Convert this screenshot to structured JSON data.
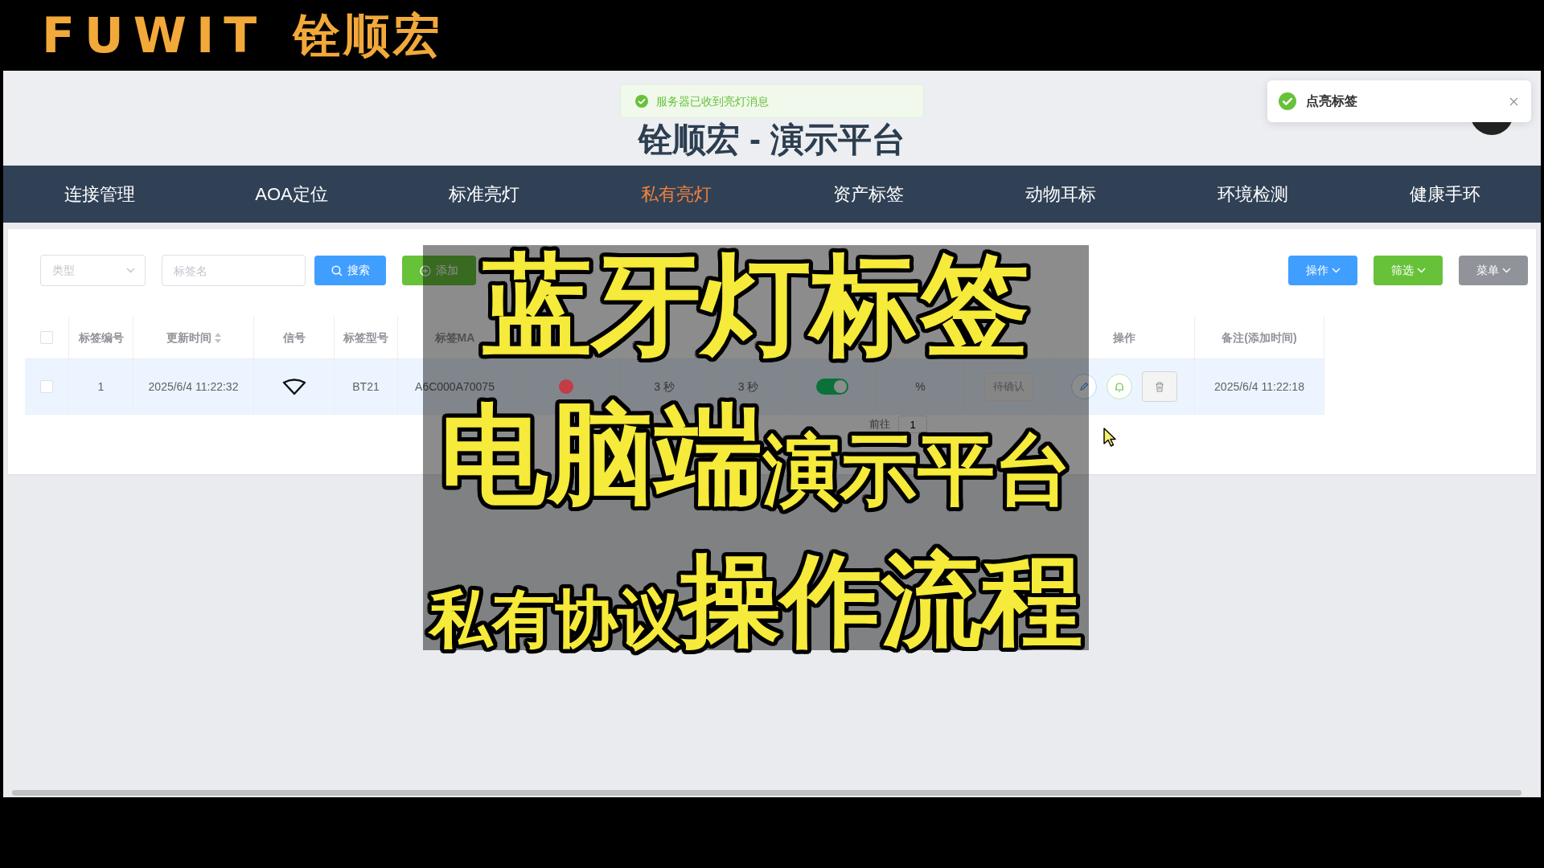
{
  "video_banner": {
    "brand": "FUWIT",
    "brand_cn": "铨顺宏"
  },
  "header": {
    "title": "铨顺宏 - 演示平台"
  },
  "message_toast": {
    "kind": "success",
    "text": "服务器已收到亮灯消息"
  },
  "notification": {
    "kind": "success",
    "title": "点亮标签"
  },
  "nav": [
    {
      "label": "连接管理",
      "selected": false
    },
    {
      "label": "AOA定位",
      "selected": false
    },
    {
      "label": "标准亮灯",
      "selected": false
    },
    {
      "label": "私有亮灯",
      "selected": true
    },
    {
      "label": "资产标签",
      "selected": false
    },
    {
      "label": "动物耳标",
      "selected": false
    },
    {
      "label": "环境检测",
      "selected": false
    },
    {
      "label": "健康手环",
      "selected": false
    }
  ],
  "toolbar": {
    "type_select": {
      "placeholder": "类型"
    },
    "name_field": {
      "placeholder": "标签名"
    },
    "left_buttons": [
      {
        "label": "搜索",
        "kind": "search"
      },
      {
        "label": "添加",
        "kind": "add"
      }
    ],
    "right_buttons": [
      {
        "label": "操作",
        "kind": "primary"
      },
      {
        "label": "筛选",
        "kind": "success"
      },
      {
        "label": "菜单",
        "kind": "info"
      }
    ]
  },
  "table": {
    "columns": [
      {
        "kind": "check",
        "checked": false
      },
      {
        "kind": "text",
        "label": "标签编号",
        "sort_icon": false
      },
      {
        "kind": "text",
        "label": "更新时间",
        "sort_icon": true
      },
      {
        "kind": "text",
        "label": "信号",
        "sort_icon": false
      },
      {
        "kind": "text",
        "label": "标签型号",
        "sort_icon": false
      },
      {
        "kind": "text",
        "label": "标签MA",
        "sort_icon": false
      },
      {
        "kind": "blank"
      },
      {
        "kind": "blank"
      },
      {
        "kind": "blank"
      },
      {
        "kind": "blank"
      },
      {
        "kind": "blank"
      },
      {
        "kind": "blank"
      },
      {
        "kind": "text",
        "label": "操作",
        "sort_icon": false
      },
      {
        "kind": "text",
        "label": "备注(添加时间)",
        "sort_icon": false
      }
    ],
    "rows": [
      {
        "hovered": true,
        "cells": [
          {
            "kind": "check",
            "checked": false
          },
          {
            "kind": "text",
            "text": "1"
          },
          {
            "kind": "text",
            "text": "2025/6/4 11:22:32"
          },
          {
            "kind": "signal"
          },
          {
            "kind": "text",
            "text": "BT21"
          },
          {
            "kind": "text",
            "text": "A6C000A70075"
          },
          {
            "kind": "dot",
            "color": "#c43c45"
          },
          {
            "kind": "text",
            "text": "3 秒"
          },
          {
            "kind": "text",
            "text": "3 秒"
          },
          {
            "kind": "switch",
            "on": true
          },
          {
            "kind": "text",
            "text": "%"
          },
          {
            "kind": "tag",
            "text": "待确认"
          },
          {
            "kind": "actions",
            "buttons": [
              {
                "kind": "edit"
              },
              {
                "kind": "bell"
              },
              {
                "kind": "delete"
              }
            ]
          },
          {
            "kind": "text",
            "text": "2025/6/4 11:22:18"
          }
        ]
      }
    ]
  },
  "pagination": {
    "goto_label": "前往",
    "page": "1"
  },
  "overlay": {
    "lines": [
      [
        {
          "text": "蓝牙灯标签",
          "kind": "major"
        }
      ],
      [
        {
          "text": "电脑端",
          "kind": "major"
        },
        {
          "text": "演示平台",
          "kind": "minor"
        }
      ],
      [
        {
          "text": "私有协议",
          "kind": "minor"
        },
        {
          "text": "操作流程",
          "kind": "major"
        }
      ]
    ]
  }
}
